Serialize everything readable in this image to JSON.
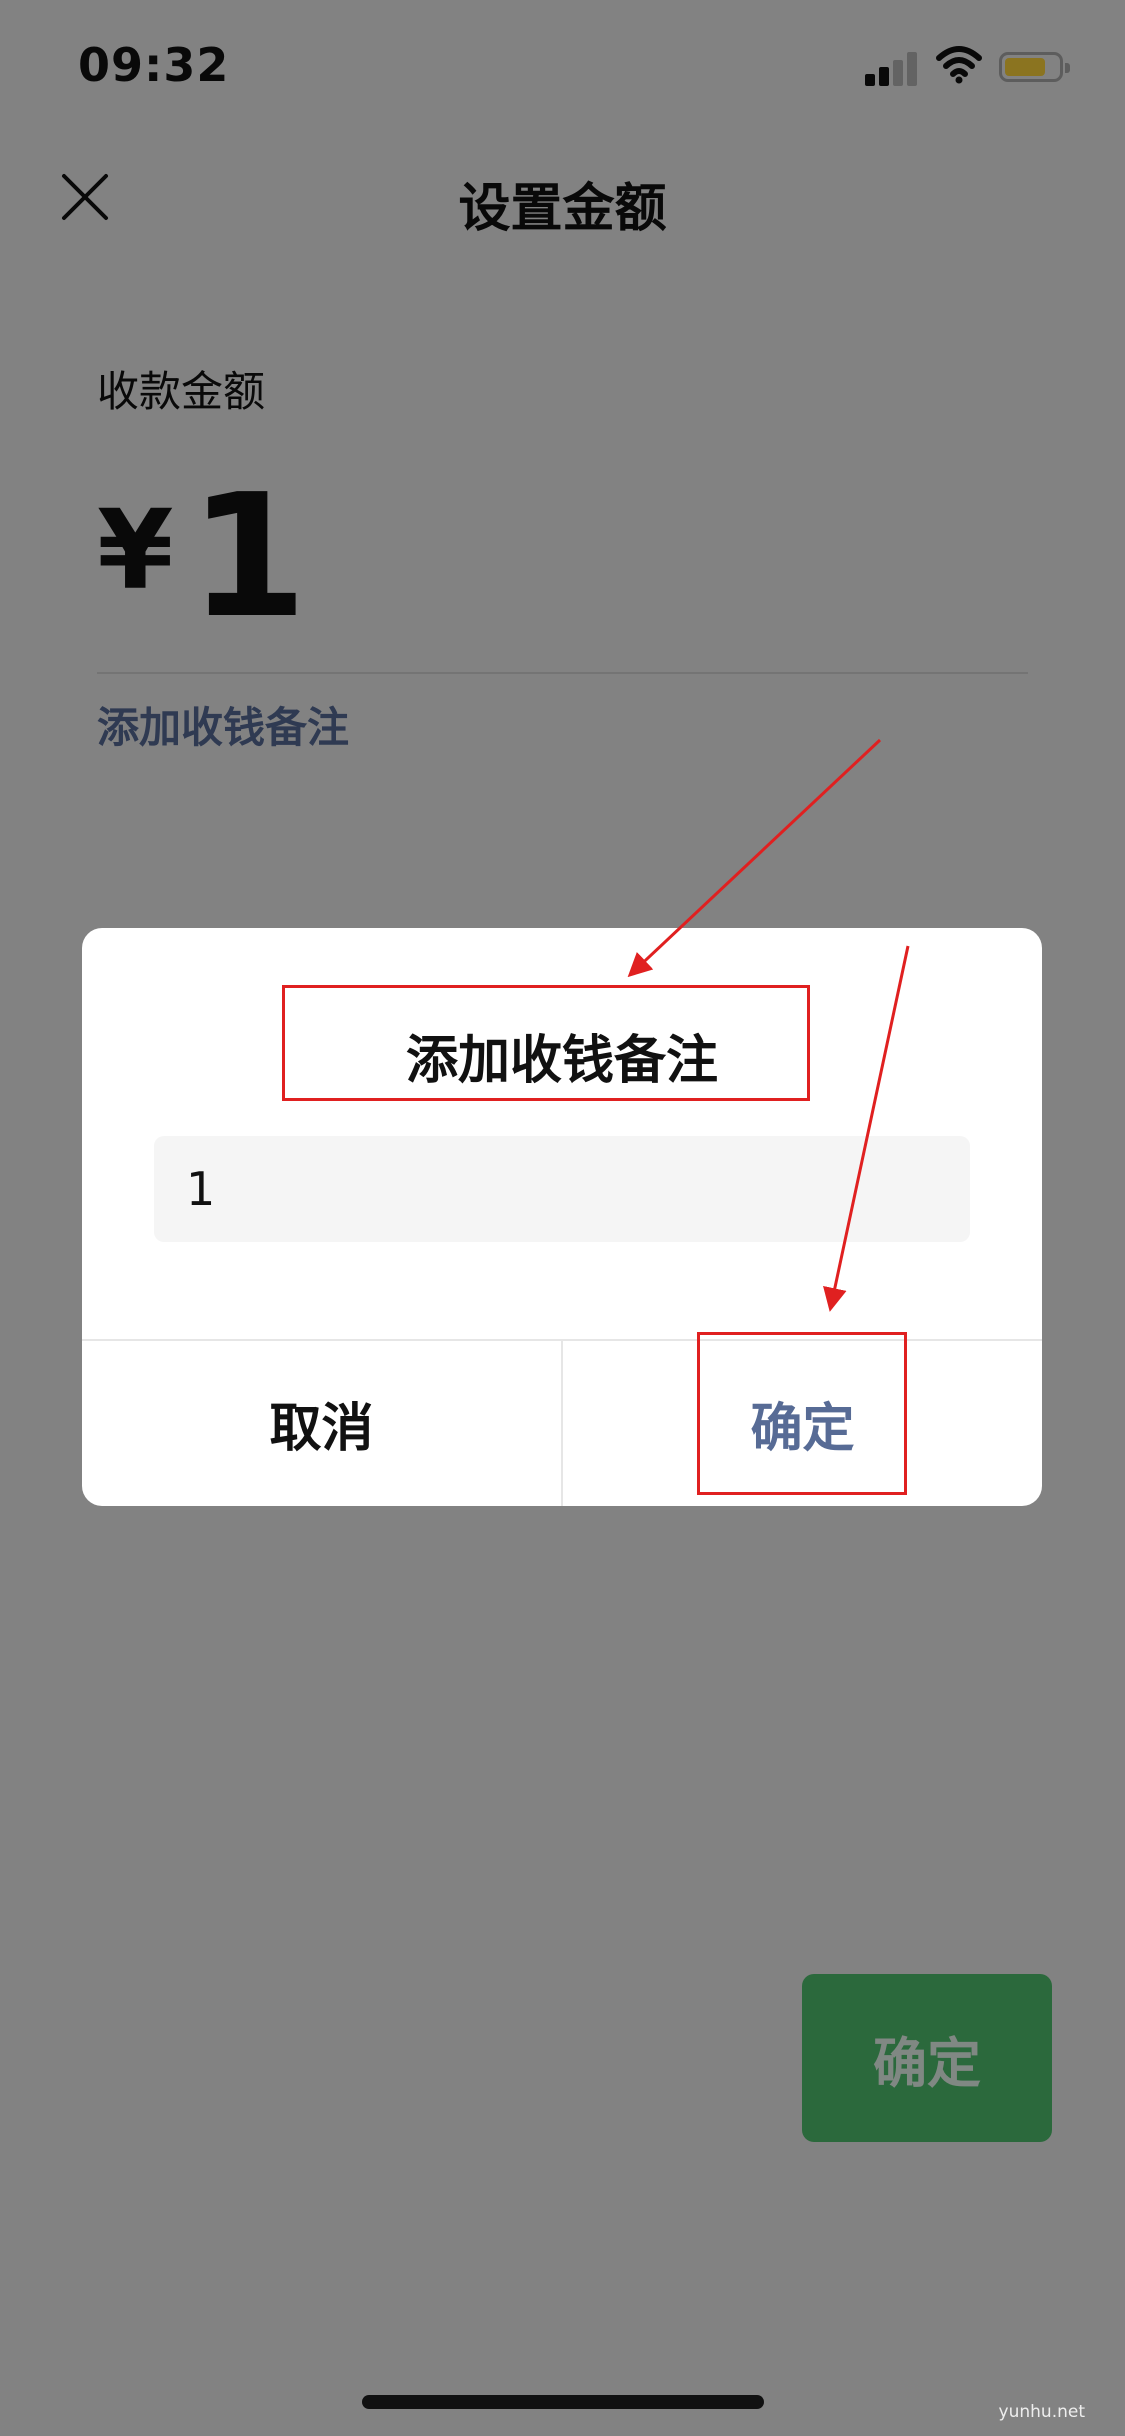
{
  "status_bar": {
    "time": "09:32",
    "signal_icon": "cellular-signal-icon",
    "wifi_icon": "wifi-icon",
    "battery_icon": "battery-icon",
    "battery_color": "#fed43b"
  },
  "nav": {
    "close_icon": "close-icon",
    "title": "设置金额"
  },
  "amount": {
    "label": "收款金额",
    "currency": "¥",
    "value": "1"
  },
  "remark_link": "添加收钱备注",
  "bottom_button": {
    "label": "确定",
    "color": "#4fc06d"
  },
  "dialog": {
    "title": "添加收钱备注",
    "input_value": "1",
    "cancel_label": "取消",
    "confirm_label": "确定",
    "confirm_color": "#576b95"
  },
  "annotations": {
    "color": "#e02020"
  },
  "watermark": "yunhu.net"
}
